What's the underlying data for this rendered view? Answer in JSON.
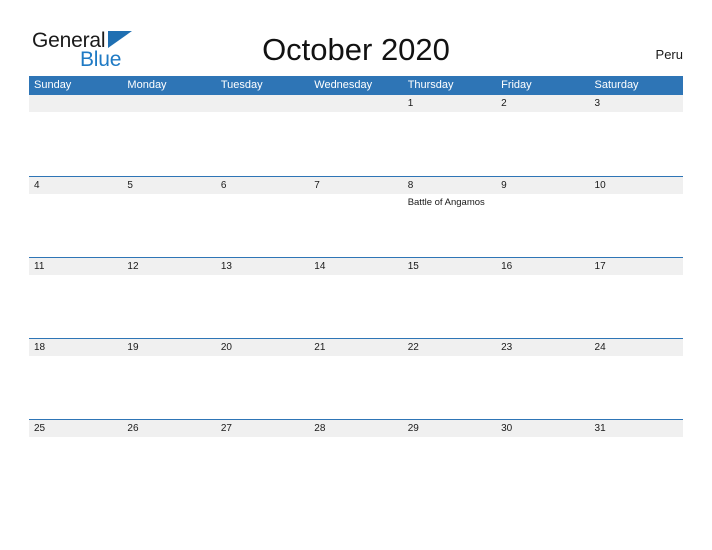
{
  "brand": {
    "name_part1": "General",
    "name_part2": "Blue",
    "flag_icon": "triangle-flag-icon",
    "color_dark": "#1a1a1a",
    "color_blue": "#1f7ac4"
  },
  "header": {
    "title": "October 2020",
    "country": "Peru"
  },
  "colors": {
    "header_blue": "#2e75b6",
    "date_strip_gray": "#f0f0f0",
    "text_dark": "#1a1a1a",
    "white": "#ffffff"
  },
  "calendar": {
    "month": "October",
    "year": "2020",
    "weekdays": [
      "Sunday",
      "Monday",
      "Tuesday",
      "Wednesday",
      "Thursday",
      "Friday",
      "Saturday"
    ],
    "weeks": [
      [
        {
          "day": "",
          "events": []
        },
        {
          "day": "",
          "events": []
        },
        {
          "day": "",
          "events": []
        },
        {
          "day": "",
          "events": []
        },
        {
          "day": "1",
          "events": []
        },
        {
          "day": "2",
          "events": []
        },
        {
          "day": "3",
          "events": []
        }
      ],
      [
        {
          "day": "4",
          "events": []
        },
        {
          "day": "5",
          "events": []
        },
        {
          "day": "6",
          "events": []
        },
        {
          "day": "7",
          "events": []
        },
        {
          "day": "8",
          "events": [
            "Battle of Angamos"
          ]
        },
        {
          "day": "9",
          "events": []
        },
        {
          "day": "10",
          "events": []
        }
      ],
      [
        {
          "day": "11",
          "events": []
        },
        {
          "day": "12",
          "events": []
        },
        {
          "day": "13",
          "events": []
        },
        {
          "day": "14",
          "events": []
        },
        {
          "day": "15",
          "events": []
        },
        {
          "day": "16",
          "events": []
        },
        {
          "day": "17",
          "events": []
        }
      ],
      [
        {
          "day": "18",
          "events": []
        },
        {
          "day": "19",
          "events": []
        },
        {
          "day": "20",
          "events": []
        },
        {
          "day": "21",
          "events": []
        },
        {
          "day": "22",
          "events": []
        },
        {
          "day": "23",
          "events": []
        },
        {
          "day": "24",
          "events": []
        }
      ],
      [
        {
          "day": "25",
          "events": []
        },
        {
          "day": "26",
          "events": []
        },
        {
          "day": "27",
          "events": []
        },
        {
          "day": "28",
          "events": []
        },
        {
          "day": "29",
          "events": []
        },
        {
          "day": "30",
          "events": []
        },
        {
          "day": "31",
          "events": []
        }
      ]
    ]
  }
}
